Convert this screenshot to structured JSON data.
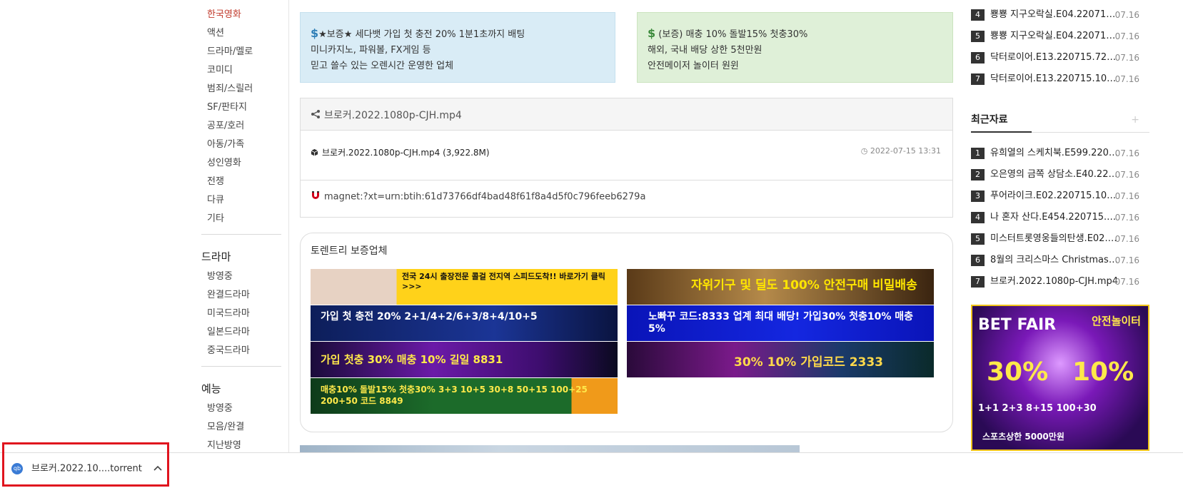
{
  "left_nav": {
    "movie_items": [
      "한국영화",
      "액션",
      "드라마/멜로",
      "코미디",
      "범죄/스릴러",
      "SF/판타지",
      "공포/호러",
      "아동/가족",
      "성인영화",
      "전쟁",
      "다큐",
      "기타"
    ],
    "drama_heading": "드라마",
    "drama_items": [
      "방영중",
      "완결드라마",
      "미국드라마",
      "일본드라마",
      "중국드라마"
    ],
    "variety_heading": "예능",
    "variety_items": [
      "방영중",
      "모음/완결",
      "지난방영"
    ]
  },
  "ads": {
    "blue": {
      "dollar": "$",
      "line1": "★보증★ 세다뱃 가입 첫 충전 20% 1분1초까지 배팅",
      "line2": "미니카지노, 파워볼, FX게임 등",
      "line3": "믿고 쓸수 있는 오렌시간 운영한 업체"
    },
    "green": {
      "dollar": "$",
      "line1": "(보증) 매충 10% 돌발15% 첫충30%",
      "line2": "해외, 국내 배당 상한 5천만원",
      "line3": "안전메이저 놀이터 원윈"
    }
  },
  "file_panel": {
    "title": "브로커.2022.1080p-CJH.mp4",
    "file_name": "브로커.2022.1080p-CJH.mp4 (3,922.8M)",
    "date": "2022-07-15 13:31",
    "magnet": "magnet:?xt=urn:btih:61d73766df4bad48f61f8a4d5f0c796feeb6279a"
  },
  "partners": {
    "title": "토렌트리 보증업체",
    "banners": {
      "b1": "전국 24시 출장전문 콜걸 전지역 스피드도착!! 바로가기 클릭 >>>",
      "b2": "가입 첫 충전 20% 2+1/4+2/6+3/8+4/10+5",
      "b3": "가입 첫충 30% 매충 10% 길일 8831",
      "b4": "매충10% 돌발15% 첫충30% 3+3 10+5 30+8 50+15 100+25 200+50 코드 8849",
      "b5": "자위기구 및 딜도 100% 안전구매 비밀배송",
      "b6": "노빠꾸 코드:8333 업계 최대 배당! 가입30% 첫충10% 매충5%",
      "b7": "30% 10% 가입코드 2333"
    }
  },
  "right_sidebar": {
    "top_list": [
      {
        "num": "4",
        "title": "뿅뿅 지구오락실.E04.220715…",
        "date": "07.16"
      },
      {
        "num": "5",
        "title": "뿅뿅 지구오락실.E04.220715…",
        "date": "07.16"
      },
      {
        "num": "6",
        "title": "닥터로이어.E13.220715.720…",
        "date": "07.16"
      },
      {
        "num": "7",
        "title": "닥터로이어.E13.220715.108…",
        "date": "07.16"
      }
    ],
    "recent_heading": "최근자료",
    "recent_plus": "+",
    "recent_list": [
      {
        "num": "1",
        "title": "유희열의 스케치북.E599.220715…",
        "date": "07.16"
      },
      {
        "num": "2",
        "title": "오은영의 금쪽 상담소.E40.22071…",
        "date": "07.16"
      },
      {
        "num": "3",
        "title": "푸어라이크.E02.220715.108…",
        "date": "07.16"
      },
      {
        "num": "4",
        "title": "나 혼자 산다.E454.220715.1…",
        "date": "07.16"
      },
      {
        "num": "5",
        "title": "미스터트롯영웅들의탄생.E02.…",
        "date": "07.16"
      },
      {
        "num": "6",
        "title": "8월의 크리스마스 Christmas I…",
        "date": "07.16"
      },
      {
        "num": "7",
        "title": "브로커.2022.1080p-CJH.mp4",
        "date": "07.16"
      }
    ],
    "ad_text": {
      "brand": "BET FAIR",
      "top": "안전놀이터",
      "p1": "30%",
      "p2": "10%",
      "bonus": "1+1 2+3 8+15 100+30",
      "limit": "스포츠상한 5000만원"
    }
  },
  "download_bar": {
    "filename": "브로커.2022.10....torrent",
    "badge": "qb"
  },
  "colors": {
    "active_nav": "#c0392b",
    "highlight_border": "#e0141e"
  }
}
